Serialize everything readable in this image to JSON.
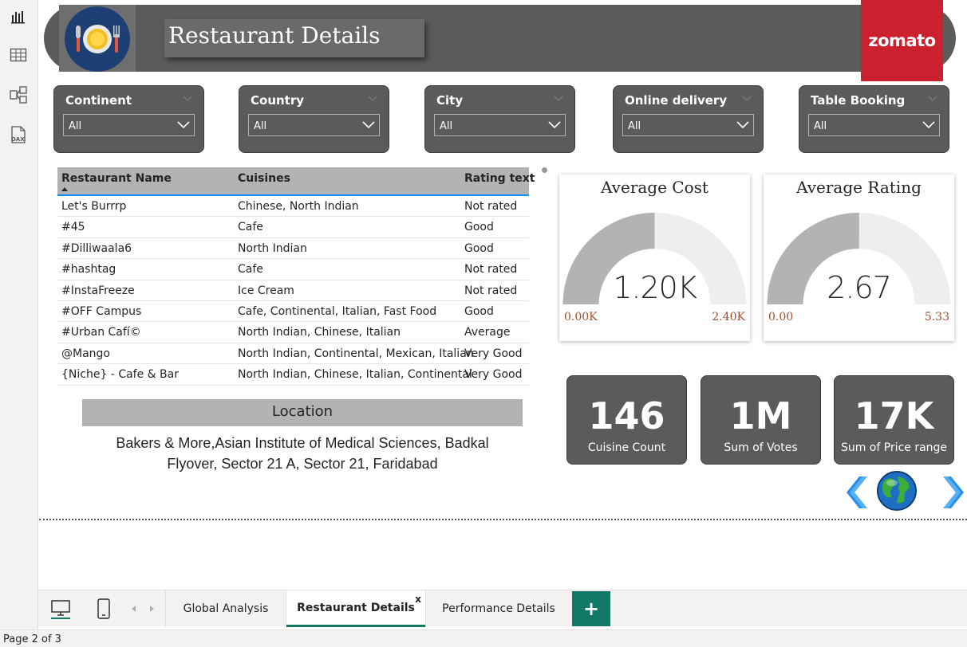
{
  "header": {
    "title": "Restaurant Details",
    "brand": "zomato",
    "logo_icon": "plate-cutlery-icon"
  },
  "colors": {
    "header_bg": "#5b5b5b",
    "brand_red": "#cb202d",
    "accent_green": "#117865",
    "gauge_fill": "#b3b3b3",
    "gauge_track": "#efeeec",
    "gauge_label": "#a0522d",
    "nav_arrow": "#1e90ff"
  },
  "slicers": [
    {
      "title": "Continent",
      "value": "All"
    },
    {
      "title": "Country",
      "value": "All"
    },
    {
      "title": "City",
      "value": "All"
    },
    {
      "title": "Online delivery",
      "value": "All"
    },
    {
      "title": "Table Booking",
      "value": "All"
    }
  ],
  "table": {
    "columns": [
      "Restaurant Name",
      "Cuisines",
      "Rating text"
    ],
    "rows": [
      [
        "Let's Burrrp",
        "Chinese, North Indian",
        "Not rated"
      ],
      [
        "#45",
        "Cafe",
        "Good"
      ],
      [
        "#Dilliwaala6",
        "North Indian",
        "Good"
      ],
      [
        "#hashtag",
        "Cafe",
        "Not rated"
      ],
      [
        "#InstaFreeze",
        "Ice Cream",
        "Not rated"
      ],
      [
        "#OFF Campus",
        "Cafe, Continental, Italian, Fast Food",
        "Good"
      ],
      [
        "#Urban Cafí©",
        "North Indian, Chinese, Italian",
        "Average"
      ],
      [
        "@Mango",
        "North Indian, Continental, Mexican, Italian",
        "Very Good"
      ],
      [
        "{Niche} - Cafe & Bar",
        "North Indian, Chinese, Italian, Continental",
        "Very Good"
      ]
    ]
  },
  "location": {
    "title": "Location",
    "address_line1": "Bakers & More,Asian Institute of Medical Sciences, Badkal",
    "address_line2": "Flyover, Sector 21 A, Sector 21, Faridabad"
  },
  "gauges": [
    {
      "title": "Average Cost",
      "value_label": "1.20K",
      "min_label": "0.00K",
      "max_label": "2.40K",
      "value": 1200,
      "min": 0,
      "max": 2400
    },
    {
      "title": "Average Rating",
      "value_label": "2.67",
      "min_label": "0.00",
      "max_label": "5.33",
      "value": 2.67,
      "min": 0,
      "max": 5.33
    }
  ],
  "kpis": [
    {
      "value": "146",
      "label": "Cuisine Count"
    },
    {
      "value": "1M",
      "label": "Sum of Votes"
    },
    {
      "value": "17K",
      "label": "Sum of Price range"
    }
  ],
  "nav": {
    "prev_icon": "chevron-left-icon",
    "globe_icon": "globe-icon",
    "next_icon": "chevron-right-icon"
  },
  "tabs": {
    "pages": [
      "Global Analysis",
      "Restaurant Details",
      "Performance Details"
    ],
    "active_index": 1,
    "close_label": "x",
    "add_label": "+"
  },
  "status": {
    "page_label": "Page 2 of 3"
  },
  "rail": {
    "icons": [
      "report-view-icon",
      "table-view-icon",
      "model-view-icon",
      "dax-query-icon"
    ]
  }
}
